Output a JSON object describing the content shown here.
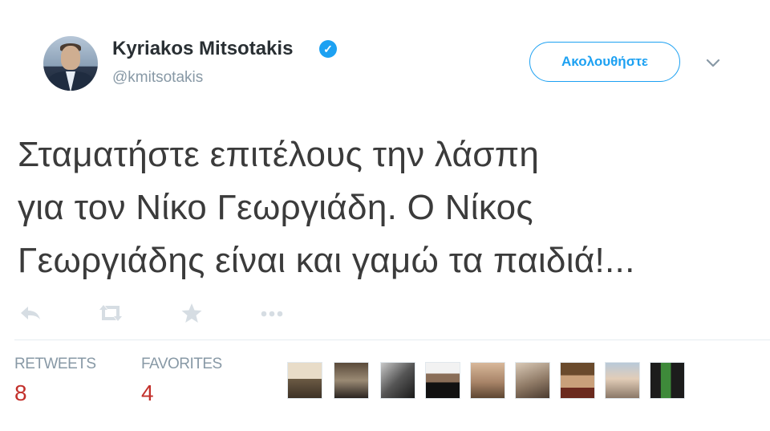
{
  "user": {
    "display_name": "Kyriakos Mitsotakis",
    "handle": "@kmitsotakis",
    "verified_icon": "verified-badge-icon"
  },
  "follow_button": {
    "label": "Ακολουθήστε"
  },
  "menu": {
    "icon": "chevron-down-icon"
  },
  "tweet": {
    "text": "Σταματήστε επιτέλους την λάσπη\nγια τον Νίκο Γεωργιάδη. Ο Νίκος\nΓεωργιάδης είναι και γαμώ τα παιδιά!..."
  },
  "actions": [
    {
      "name": "reply-icon"
    },
    {
      "name": "retweet-icon"
    },
    {
      "name": "favorite-star-icon"
    },
    {
      "name": "more-dots-icon"
    }
  ],
  "stats": {
    "retweets_label": "RETWEETS",
    "retweets_value": "8",
    "favorites_label": "FAVORITES",
    "favorites_value": "4"
  },
  "colors": {
    "accent": "#1da1f2",
    "name_text": "#292f33",
    "secondary_text": "#8899a6",
    "count_text": "#c3302b",
    "tweet_text": "#3b3b3b"
  }
}
